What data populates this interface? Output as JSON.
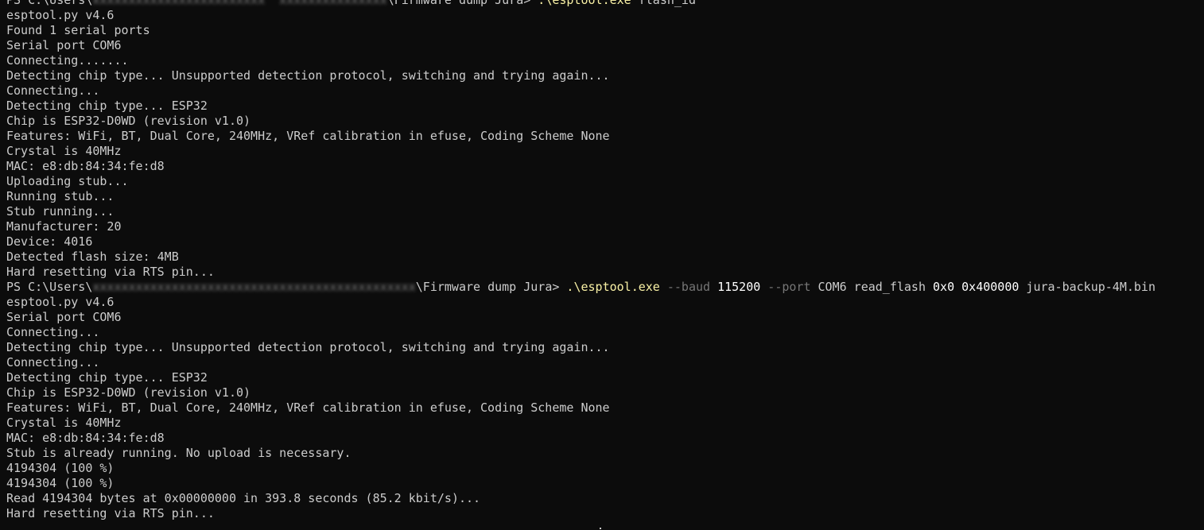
{
  "prompt1": {
    "prefix": "PS C:\\Users\\",
    "redacted": "xxxxxxxxxxxxxxxxxxxxxxxx  xxxxxxxxxxxxxxx",
    "suffix": "\\Firmware dump Jura> ",
    "exe": ".\\esptool.exe",
    "args": " flash_id"
  },
  "block1": [
    "esptool.py v4.6",
    "Found 1 serial ports",
    "Serial port COM6",
    "Connecting.......",
    "Detecting chip type... Unsupported detection protocol, switching and trying again...",
    "Connecting...",
    "Detecting chip type... ESP32",
    "Chip is ESP32-D0WD (revision v1.0)",
    "Features: WiFi, BT, Dual Core, 240MHz, VRef calibration in efuse, Coding Scheme None",
    "Crystal is 40MHz",
    "MAC: e8:db:84:34:fe:d8",
    "Uploading stub...",
    "Running stub...",
    "Stub running...",
    "Manufacturer: 20",
    "Device: 4016",
    "Detected flash size: 4MB",
    "Hard resetting via RTS pin..."
  ],
  "prompt2": {
    "prefix": "PS C:\\Users\\",
    "redacted": "xxxxxxxxxxxxxxxxxxxxxxxxxxxxxxxxxxxxxxxxxxxxx",
    "suffix": "\\Firmware dump Jura> ",
    "exe": ".\\esptool.exe",
    "flag_baud": " --baud",
    "baud": " 115200",
    "flag_port": " --port",
    "port_arg": " COM6 read_flash",
    "addr": " 0x0",
    "size": " 0x400000",
    "file": " jura-backup-4M.bin"
  },
  "block2": [
    "esptool.py v4.6",
    "Serial port COM6",
    "Connecting...",
    "Detecting chip type... Unsupported detection protocol, switching and trying again...",
    "Connecting...",
    "Detecting chip type... ESP32",
    "Chip is ESP32-D0WD (revision v1.0)",
    "Features: WiFi, BT, Dual Core, 240MHz, VRef calibration in efuse, Coding Scheme None",
    "Crystal is 40MHz",
    "MAC: e8:db:84:34:fe:d8",
    "Stub is already running. No upload is necessary.",
    "4194304 (100 %)",
    "4194304 (100 %)",
    "Read 4194304 bytes at 0x00000000 in 393.8 seconds (85.2 kbit/s)...",
    "Hard resetting via RTS pin..."
  ]
}
